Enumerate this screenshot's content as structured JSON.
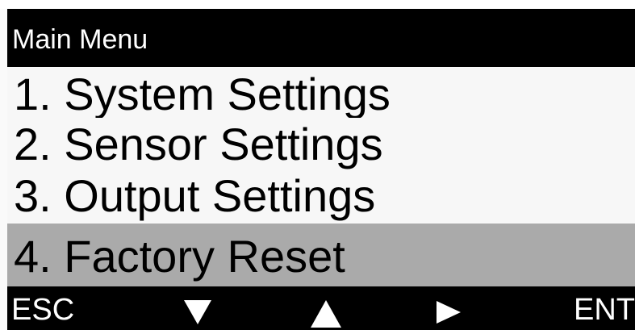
{
  "header": {
    "title": "Main Menu"
  },
  "menu": {
    "items": [
      {
        "label": "1. System Settings",
        "selected": false
      },
      {
        "label": "2. Sensor Settings",
        "selected": false
      },
      {
        "label": "3. Output Settings",
        "selected": false
      },
      {
        "label": "4. Factory Reset",
        "selected": true
      }
    ]
  },
  "soft_keys": {
    "esc_label": "ESC",
    "down_icon": "triangle-down-icon",
    "up_icon": "triangle-up-icon",
    "right_icon": "triangle-right-icon",
    "ent_label": "ENT"
  },
  "colors": {
    "header_bg": "#000000",
    "header_text": "#ffffff",
    "selected_bg": "#aaaaaa",
    "menu_bg": "#f7f7f7"
  }
}
